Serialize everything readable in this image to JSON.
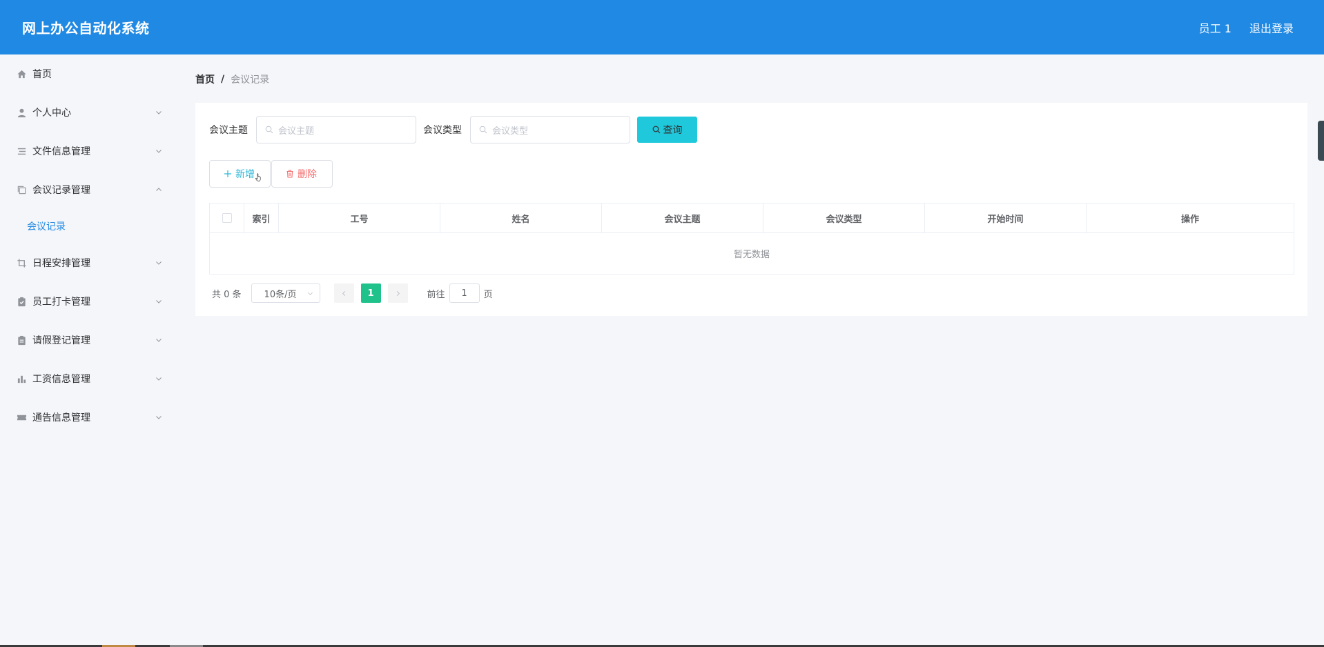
{
  "header": {
    "app_title": "网上办公自动化系统",
    "user_label": "员工 1",
    "logout_label": "退出登录",
    "bg_color": "#2089e3"
  },
  "sidebar": {
    "items": [
      {
        "label": "首页",
        "icon": "home-icon",
        "has_arrow": false
      },
      {
        "label": "个人中心",
        "icon": "user-icon",
        "has_arrow": true,
        "expanded": false
      },
      {
        "label": "文件信息管理",
        "icon": "list-icon",
        "has_arrow": true,
        "expanded": false
      },
      {
        "label": "会议记录管理",
        "icon": "copy-icon",
        "has_arrow": true,
        "expanded": true,
        "children": [
          {
            "label": "会议记录",
            "active": true
          }
        ]
      },
      {
        "label": "日程安排管理",
        "icon": "crop-icon",
        "has_arrow": true,
        "expanded": false
      },
      {
        "label": "员工打卡管理",
        "icon": "clipboard-check-icon",
        "has_arrow": true,
        "expanded": false
      },
      {
        "label": "请假登记管理",
        "icon": "clipboard-icon",
        "has_arrow": true,
        "expanded": false
      },
      {
        "label": "工资信息管理",
        "icon": "bar-chart-icon",
        "has_arrow": true,
        "expanded": false
      },
      {
        "label": "通告信息管理",
        "icon": "ticket-icon",
        "has_arrow": true,
        "expanded": false
      }
    ]
  },
  "breadcrumb": {
    "home": "首页",
    "separator": "/",
    "current": "会议记录"
  },
  "search": {
    "field1_label": "会议主题",
    "field1_placeholder": "会议主题",
    "field2_label": "会议类型",
    "field2_placeholder": "会议类型",
    "query_label": "查询"
  },
  "actions": {
    "add_label": "新增",
    "delete_label": "删除"
  },
  "table": {
    "columns": [
      "",
      "索引",
      "工号",
      "姓名",
      "会议主题",
      "会议类型",
      "开始时间",
      "操作"
    ],
    "rows": [],
    "empty_text": "暂无数据"
  },
  "pagination": {
    "total_text": "共 0 条",
    "page_size": "10条/页",
    "current_page": "1",
    "goto_label": "前往",
    "goto_value": "1",
    "page_suffix": "页"
  },
  "colors": {
    "accent": "#2089e3",
    "query_button": "#1fc8db",
    "active_page": "#1fc28a",
    "danger": "#f56c6c"
  }
}
